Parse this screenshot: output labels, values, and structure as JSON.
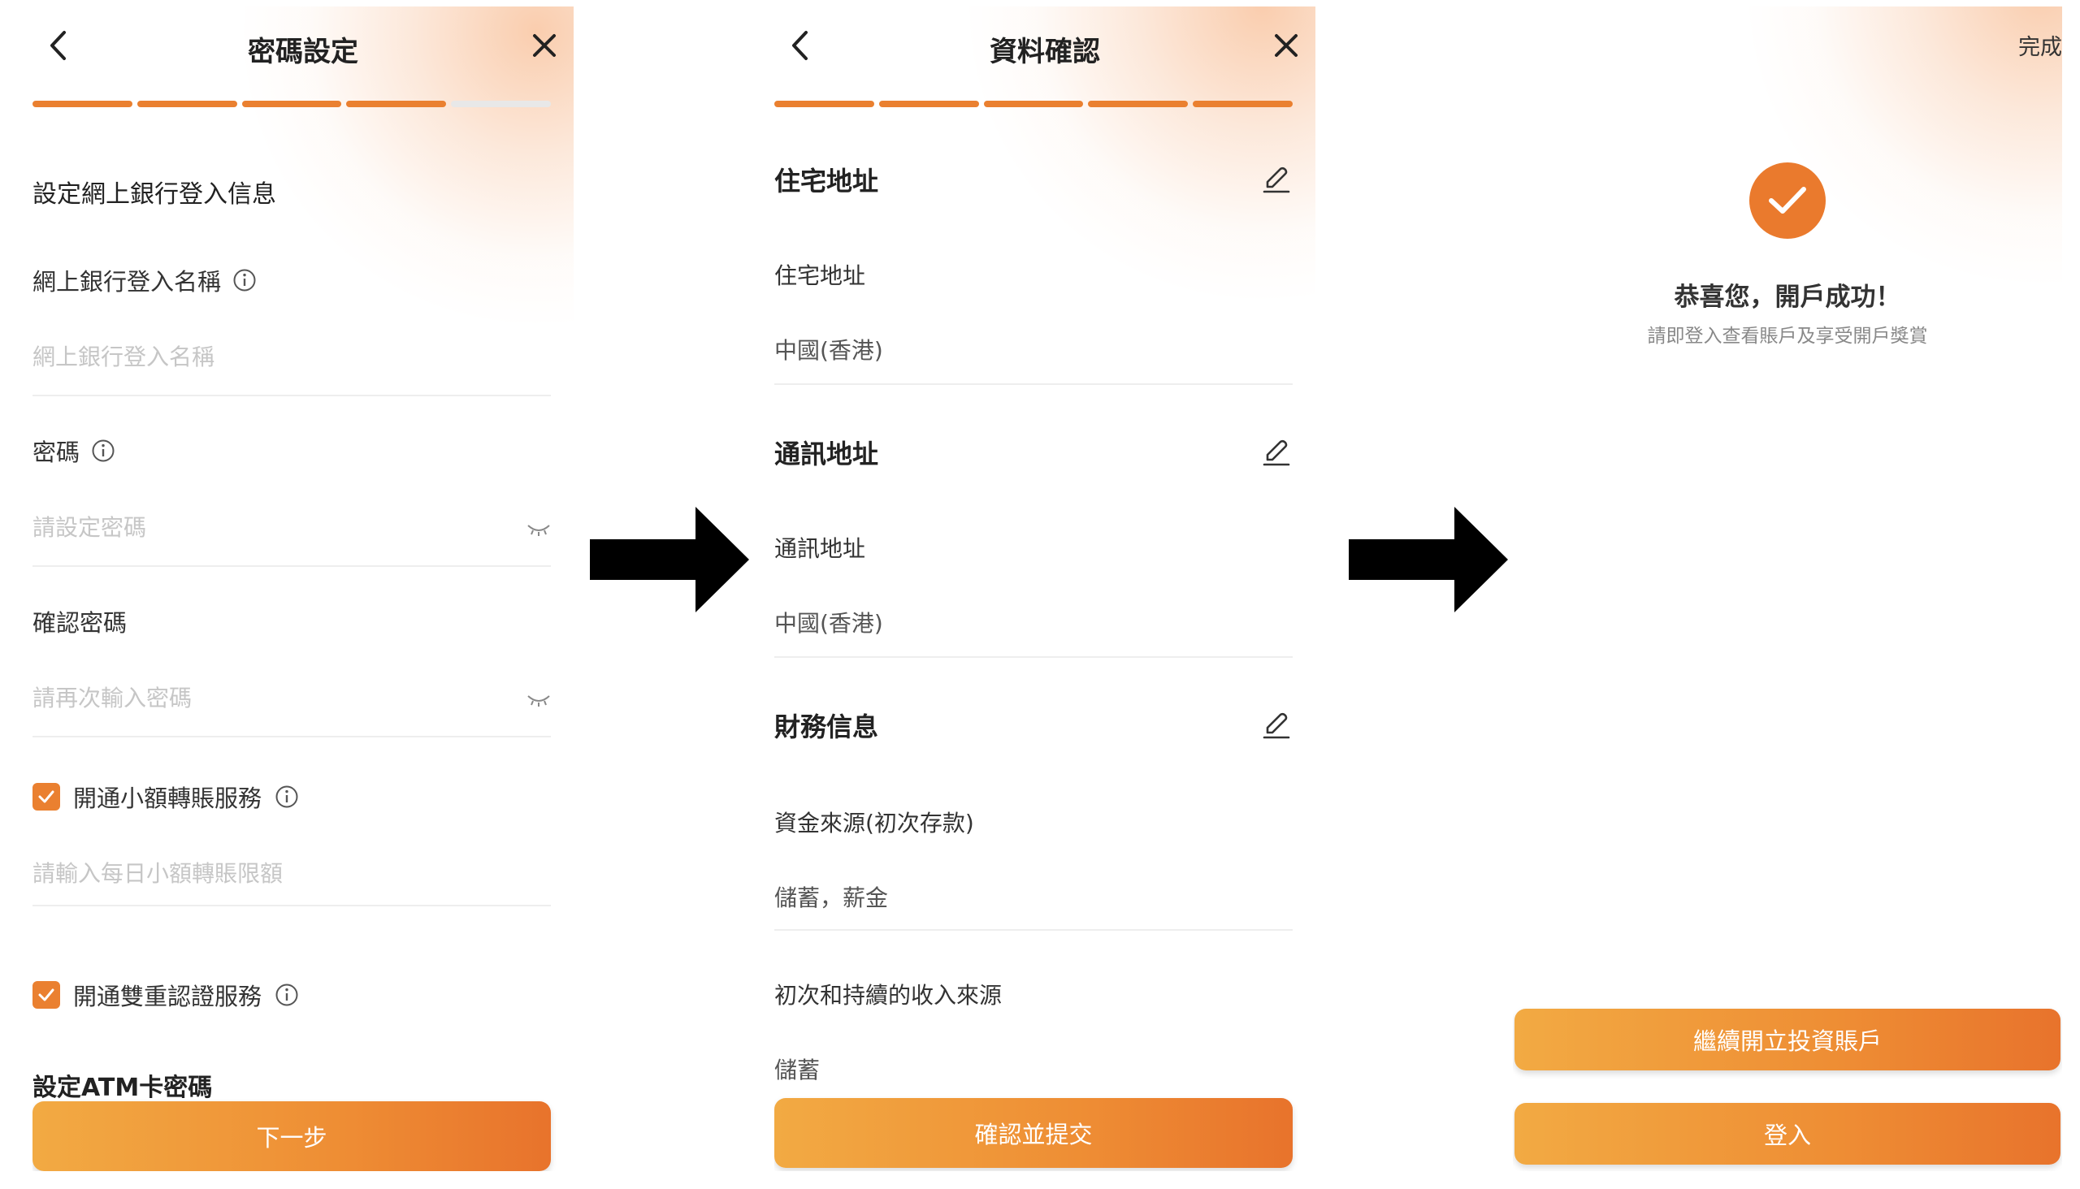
{
  "colors": {
    "accent": "#ea8030",
    "arrow": "#000000",
    "divider": "#eeeeee"
  },
  "screen1": {
    "title": "密碼設定",
    "back_icon": "chevron-left-icon",
    "close_icon": "close-icon",
    "progress": {
      "total_steps": 5,
      "completed_steps": 4
    },
    "section_title": "設定網上銀行登入信息",
    "login_name": {
      "label": "網上銀行登入名稱",
      "placeholder": "網上銀行登入名稱"
    },
    "password": {
      "label": "密碼",
      "placeholder": "請設定密碼"
    },
    "confirm_password": {
      "label": "確認密碼",
      "placeholder": "請再次輸入密碼"
    },
    "small_transfer": {
      "label": "開通小額轉賬服務",
      "checked": true,
      "placeholder": "請輸入每日小額轉賬限額"
    },
    "two_factor": {
      "label": "開通雙重認證服務",
      "checked": true
    },
    "atm_title": "設定ATM卡密碼",
    "next_button": "下一步"
  },
  "screen2": {
    "title": "資料確認",
    "back_icon": "chevron-left-icon",
    "close_icon": "close-icon",
    "progress": {
      "total_steps": 5,
      "completed_steps": 5
    },
    "residential": {
      "title": "住宅地址",
      "label": "住宅地址",
      "value": "中國(香港)"
    },
    "mailing": {
      "title": "通訊地址",
      "label": "通訊地址",
      "value": "中國(香港)"
    },
    "financial": {
      "title": "財務信息",
      "fund_source_label": "資金來源(初次存款)",
      "fund_source_value": "儲蓄，薪金",
      "income_source_label": "初次和持續的收入來源",
      "income_source_value": "儲蓄"
    },
    "submit_button": "確認並提交"
  },
  "screen3": {
    "done": "完成",
    "success_icon": "check-icon",
    "title": "恭喜您，開戶成功！",
    "subtitle": "請即登入查看賬戶及享受開戶獎賞",
    "invest_button": "繼續開立投資賬戶",
    "login_button": "登入"
  }
}
